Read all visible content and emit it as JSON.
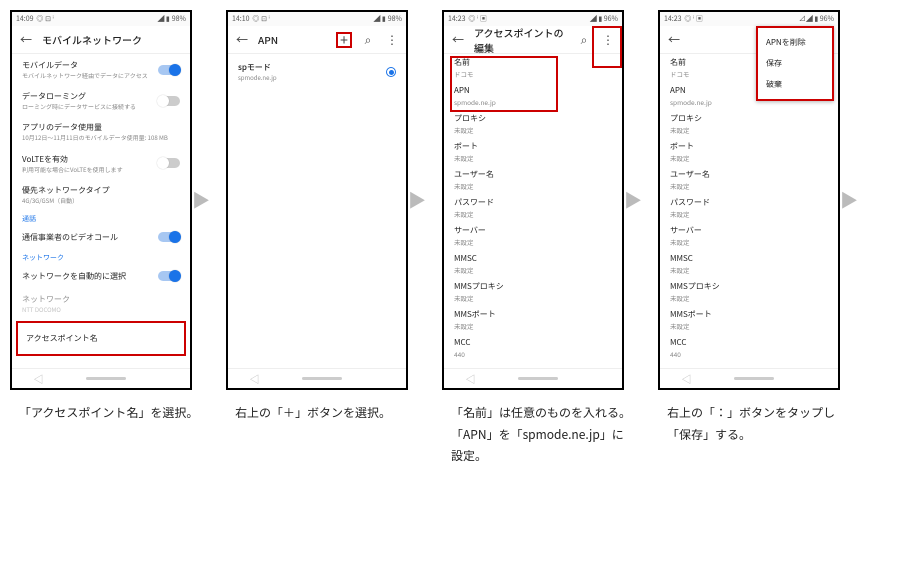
{
  "status": {
    "time1": "14:09",
    "time2": "14:10",
    "time3": "14:23",
    "time4": "14:23",
    "battery": "98%"
  },
  "screen1": {
    "title": "モバイルネットワーク",
    "items": [
      {
        "title": "モバイルデータ",
        "sub": "モバイルネットワーク経由でデータにアクセス",
        "on": true
      },
      {
        "title": "データローミング",
        "sub": "ローミング時にデータサービスに接続する",
        "on": false
      },
      {
        "title": "アプリのデータ使用量",
        "sub": "10月12日〜11月11日のモバイルデータ使用量: 108 MB"
      },
      {
        "title": "VoLTEを有効",
        "sub": "利用可能な場合にVoLTEを使用します",
        "on": false
      },
      {
        "title": "優先ネットワークタイプ",
        "sub": "4G/3G/GSM（自動）"
      }
    ],
    "section_call": "通話",
    "call_item": {
      "title": "通信事業者のビデオコール",
      "on": true
    },
    "section_net": "ネットワーク",
    "net_auto": {
      "title": "ネットワークを自動的に選択",
      "on": true
    },
    "net_name": {
      "title": "ネットワーク",
      "sub": "NTT DOCOMO"
    },
    "apn": {
      "title": "アクセスポイント名"
    }
  },
  "screen2": {
    "title": "APN",
    "apn_name": "spモード",
    "apn_val": "spmode.ne.jp"
  },
  "screen3": {
    "title": "アクセスポイントの編集",
    "fields": [
      {
        "label": "名前",
        "val": "ドコモ"
      },
      {
        "label": "APN",
        "val": "spmode.ne.jp"
      },
      {
        "label": "プロキシ",
        "val": "未設定"
      },
      {
        "label": "ポート",
        "val": "未設定"
      },
      {
        "label": "ユーザー名",
        "val": "未設定"
      },
      {
        "label": "パスワード",
        "val": "未設定"
      },
      {
        "label": "サーバー",
        "val": "未設定"
      },
      {
        "label": "MMSC",
        "val": "未設定"
      },
      {
        "label": "MMSプロキシ",
        "val": "未設定"
      },
      {
        "label": "MMSポート",
        "val": "未設定"
      },
      {
        "label": "MCC",
        "val": "440"
      }
    ]
  },
  "screen4": {
    "menu": [
      "APNを削除",
      "保存",
      "破棄"
    ]
  },
  "captions": [
    "「アクセスポイント名」を選択。",
    "右上の「＋」ボタンを選択。",
    "「名前」は任意のものを入れる。「APN」を「spmode.ne.jp」に設定。",
    "右上の「：」ボタンをタップし「保存」する。"
  ]
}
